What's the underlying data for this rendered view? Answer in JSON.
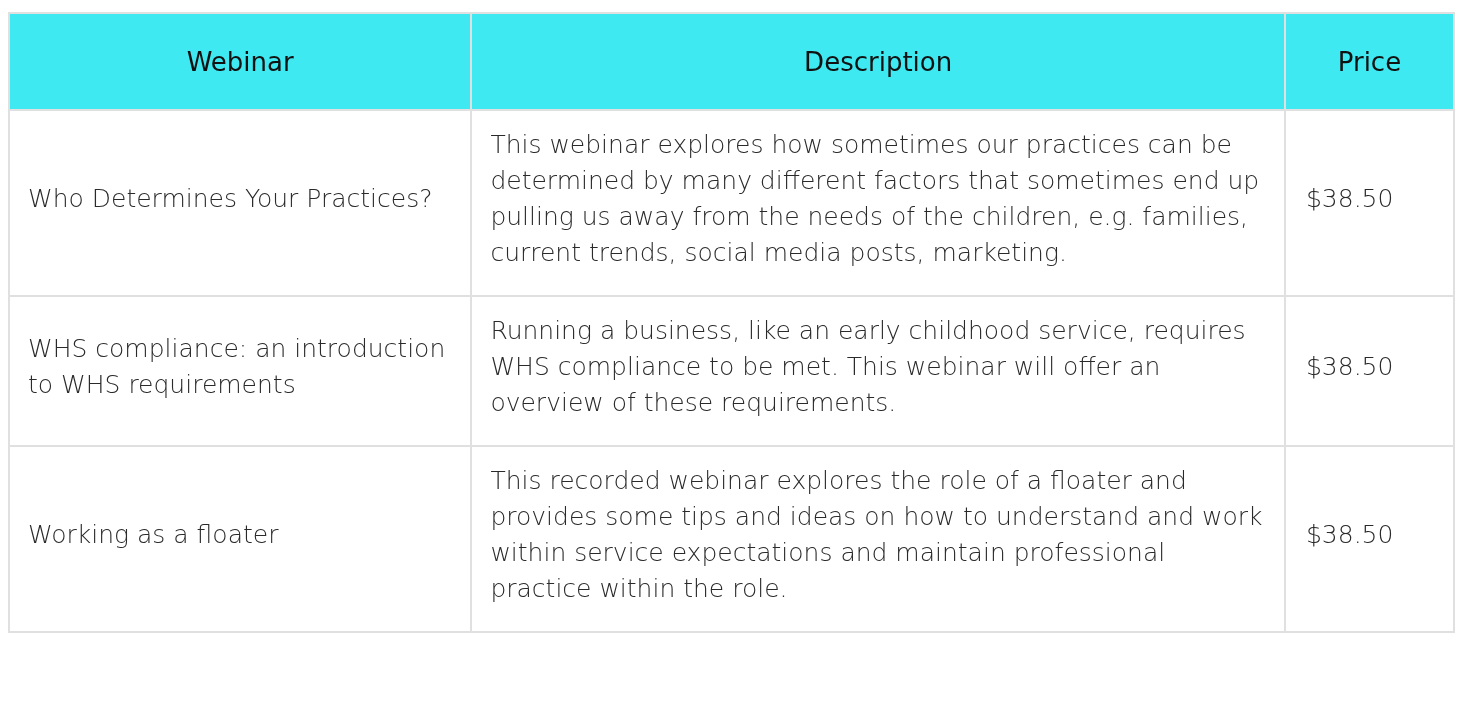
{
  "table": {
    "columns": [
      "Webinar",
      "Description",
      "Price"
    ],
    "rows": [
      {
        "webinar": "Who Determines Your Practices?",
        "description": "This webinar explores how sometimes our practices can be determined by many different factors that sometimes end up pulling us away from the needs of the children, e.g. families, current trends, social media posts, marketing.",
        "price": "$38.50"
      },
      {
        "webinar": "WHS compliance: an introduction to WHS requirements",
        "description": "Running a business, like an early childhood service, requires WHS compliance to be met. This webinar will offer an overview of these requirements.",
        "price": "$38.50"
      },
      {
        "webinar": "Working as a floater",
        "description": "This recorded webinar explores the role of a floater and provides some tips and ideas on how to understand and work within service expectations and maintain professional practice within the role.",
        "price": "$38.50"
      }
    ]
  }
}
